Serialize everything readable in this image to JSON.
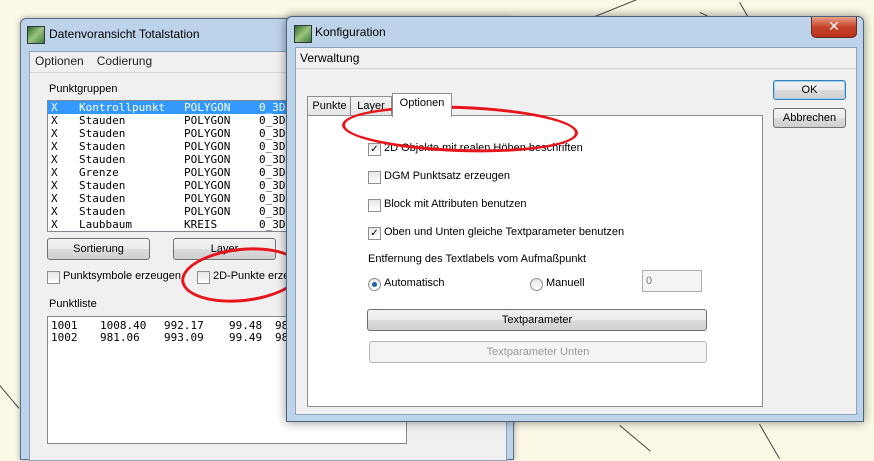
{
  "background_lines": true,
  "window_punkte": {
    "title": "Datenvoransicht Totalstation",
    "menu": [
      "Optionen",
      "Codierung"
    ],
    "punktgruppen_label": "Punktgruppen",
    "groups": [
      {
        "mark": "X",
        "name": "Kontrollpunkt",
        "type": "POLYGON",
        "layer": "0_3D",
        "selected": true
      },
      {
        "mark": "X",
        "name": "Stauden",
        "type": "POLYGON",
        "layer": "0_3D"
      },
      {
        "mark": "X",
        "name": "Stauden",
        "type": "POLYGON",
        "layer": "0_3D"
      },
      {
        "mark": "X",
        "name": "Stauden",
        "type": "POLYGON",
        "layer": "0_3D"
      },
      {
        "mark": "X",
        "name": "Stauden",
        "type": "POLYGON",
        "layer": "0_3D"
      },
      {
        "mark": "X",
        "name": "Grenze",
        "type": "POLYGON",
        "layer": "0_3D"
      },
      {
        "mark": "X",
        "name": "Stauden",
        "type": "POLYGON",
        "layer": "0_3D"
      },
      {
        "mark": "X",
        "name": "Stauden",
        "type": "POLYGON",
        "layer": "0_3D"
      },
      {
        "mark": "X",
        "name": "Stauden",
        "type": "POLYGON",
        "layer": "0_3D"
      },
      {
        "mark": "X",
        "name": "Laubbaum",
        "type": "KREIS",
        "layer": "0_3D"
      }
    ],
    "sortierung_button": "Sortierung",
    "layer_button": "Layer",
    "punktsymbole_label": "Punktsymbole erzeugen",
    "punkte2d_label": "2D-Punkte erze",
    "punktliste_label": "Punktliste",
    "points": [
      {
        "nr": "1001",
        "x": "1008.40",
        "y": "992.17",
        "z": "99.48",
        "extra": "98"
      },
      {
        "nr": "1002",
        "x": "981.06",
        "y": "993.09",
        "z": "99.49",
        "extra": "98"
      }
    ]
  },
  "window_konfig": {
    "title": "Konfiguration",
    "close_glyph": "✕",
    "menu": [
      "Verwaltung"
    ],
    "tabs": [
      {
        "label": "Punkte",
        "active": false
      },
      {
        "label": "Layer",
        "active": false
      },
      {
        "label": "Optionen",
        "active": true
      }
    ],
    "options": {
      "opt_2d_hoehen": {
        "label": "2D Objekte mit realen Höhen beschriften",
        "checked": true
      },
      "opt_dgm": {
        "label": "DGM Punktsatz erzeugen",
        "checked": false
      },
      "opt_block": {
        "label": "Block mit Attributen benutzen",
        "checked": false
      },
      "opt_oben_unten": {
        "label": "Oben und Unten gleiche Textparameter benutzen",
        "checked": true
      }
    },
    "entfernung_label": "Entfernung des Textlabels vom Aufmaßpunkt",
    "radio_automatisch": "Automatisch",
    "radio_manuell": "Manuell",
    "distance_value": "0",
    "textparameter_button": "Textparameter",
    "textparameter_unten_button": "Textparameter Unten",
    "ok_button": "OK",
    "abbrechen_button": "Abbrechen",
    "check_glyph": "✓"
  },
  "colors": {
    "selection": "#3399ff",
    "annotation_red": "#e8141a",
    "window_frame": "#bdd3ea"
  }
}
